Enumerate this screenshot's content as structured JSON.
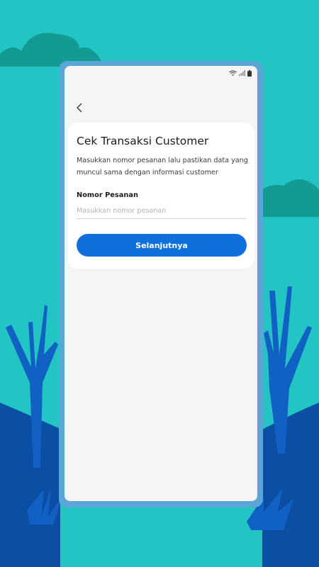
{
  "colors": {
    "background_teal": "#22c5c4",
    "cloud_dark_teal": "#139a93",
    "hill_blue": "#0a4fa3",
    "tree_blue": "#1160c4",
    "phone_frame": "#5aa6d6",
    "screen_bg": "#f5f5f8",
    "card_bg": "#ffffff",
    "primary_button": "#0f6fdc"
  },
  "status_bar": {
    "icons": [
      "wifi-icon",
      "signal-icon",
      "battery-icon"
    ]
  },
  "header": {
    "back_icon": "chevron-left-icon"
  },
  "card": {
    "title": "Cek Transaksi Customer",
    "description": "Masukkan nomor pesanan lalu pastikan data yang muncul sama dengan informasi customer",
    "order_field": {
      "label": "Nomor Pesanan",
      "placeholder": "Masukkan nomor pesanan",
      "value": ""
    },
    "next_button_label": "Selanjutnya"
  }
}
